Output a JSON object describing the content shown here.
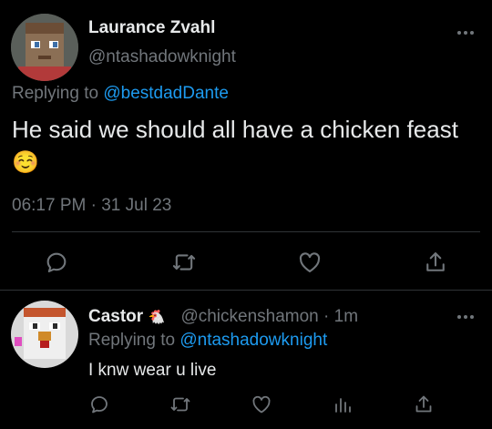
{
  "main_tweet": {
    "display_name": "Laurance Zvahl",
    "handle": "@ntashadowknight",
    "replying_to_prefix": "Replying to",
    "replying_to_handle": "@bestdadDante",
    "text": "He said we should all have a chicken feast",
    "emoji": "☺️",
    "timestamp": "06:17 PM · 31 Jul 23"
  },
  "reply_tweet": {
    "display_name": "Castor",
    "name_emoji": "🐔",
    "handle": "@chickenshamon",
    "separator": "·",
    "time": "1m",
    "replying_to_prefix": "Replying to",
    "replying_to_handle": "@ntashadowknight",
    "text": "I knw wear u live"
  },
  "icons": {
    "more": "more-dots-icon",
    "reply": "reply-bubble-icon",
    "retweet": "retweet-icon",
    "like": "heart-icon",
    "share": "share-icon",
    "views": "analytics-bars-icon"
  },
  "colors": {
    "background": "#000000",
    "text": "#e7e9ea",
    "muted": "#71767b",
    "link": "#1d9bf0",
    "divider": "#2f3336"
  }
}
